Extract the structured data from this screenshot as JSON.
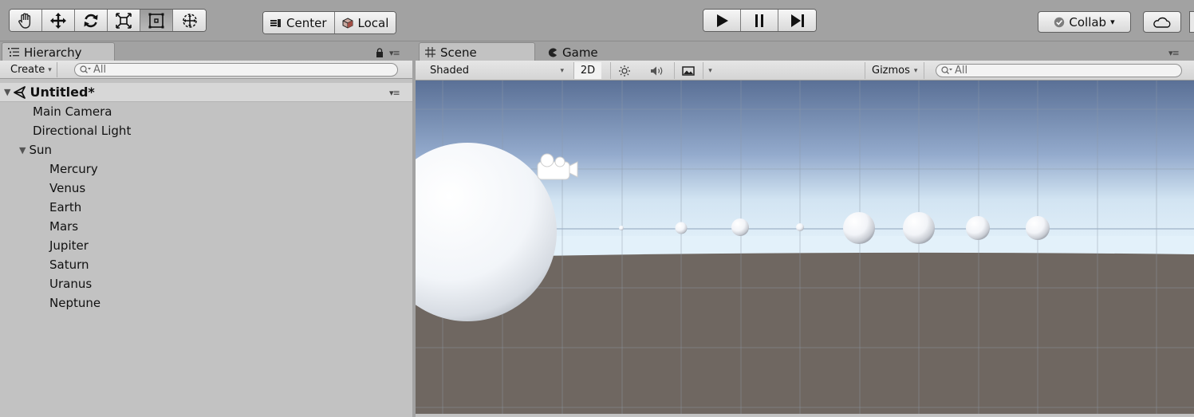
{
  "toolbar": {
    "tools": [
      {
        "name": "hand-tool",
        "icon": "hand-icon",
        "active": false
      },
      {
        "name": "move-tool",
        "icon": "move-arrows-icon",
        "active": false
      },
      {
        "name": "rotate-tool",
        "icon": "rotate-icon",
        "active": false
      },
      {
        "name": "scale-tool",
        "icon": "scale-icon",
        "active": false
      },
      {
        "name": "rect-tool",
        "icon": "rect-transform-icon",
        "active": true
      },
      {
        "name": "transform-tool",
        "icon": "transform-icon",
        "active": false
      }
    ],
    "pivot_label": "Center",
    "space_label": "Local",
    "collab_label": "Collab",
    "collab_caret": "▾"
  },
  "hierarchy": {
    "tab_label": "Hierarchy",
    "create_label": "Create",
    "create_caret": "▾",
    "search_placeholder": "All",
    "scene_name": "Untitled*",
    "items": [
      {
        "label": "Main Camera",
        "indent": 1
      },
      {
        "label": "Directional Light",
        "indent": 1
      },
      {
        "label": "Sun",
        "indent": 1,
        "expanded": true
      },
      {
        "label": "Mercury",
        "indent": 2
      },
      {
        "label": "Venus",
        "indent": 2
      },
      {
        "label": "Earth",
        "indent": 2
      },
      {
        "label": "Mars",
        "indent": 2
      },
      {
        "label": "Jupiter",
        "indent": 2
      },
      {
        "label": "Saturn",
        "indent": 2
      },
      {
        "label": "Uranus",
        "indent": 2
      },
      {
        "label": "Neptune",
        "indent": 2
      }
    ]
  },
  "scene": {
    "tabs": [
      {
        "label": "Scene",
        "icon": "grid-icon",
        "active": true
      },
      {
        "label": "Game",
        "icon": "pacman-icon",
        "active": false
      }
    ],
    "shading_mode": "Shaded",
    "shading_caret": "▾",
    "mode_2d": "2D",
    "gizmos_label": "Gizmos",
    "gizmos_caret": "▾",
    "search_placeholder": "All"
  },
  "colors": {
    "sky_top": "#5a7096",
    "sky_mid": "#93aacc",
    "horizon": "#e6f3fb",
    "ground": "#6f6761"
  }
}
